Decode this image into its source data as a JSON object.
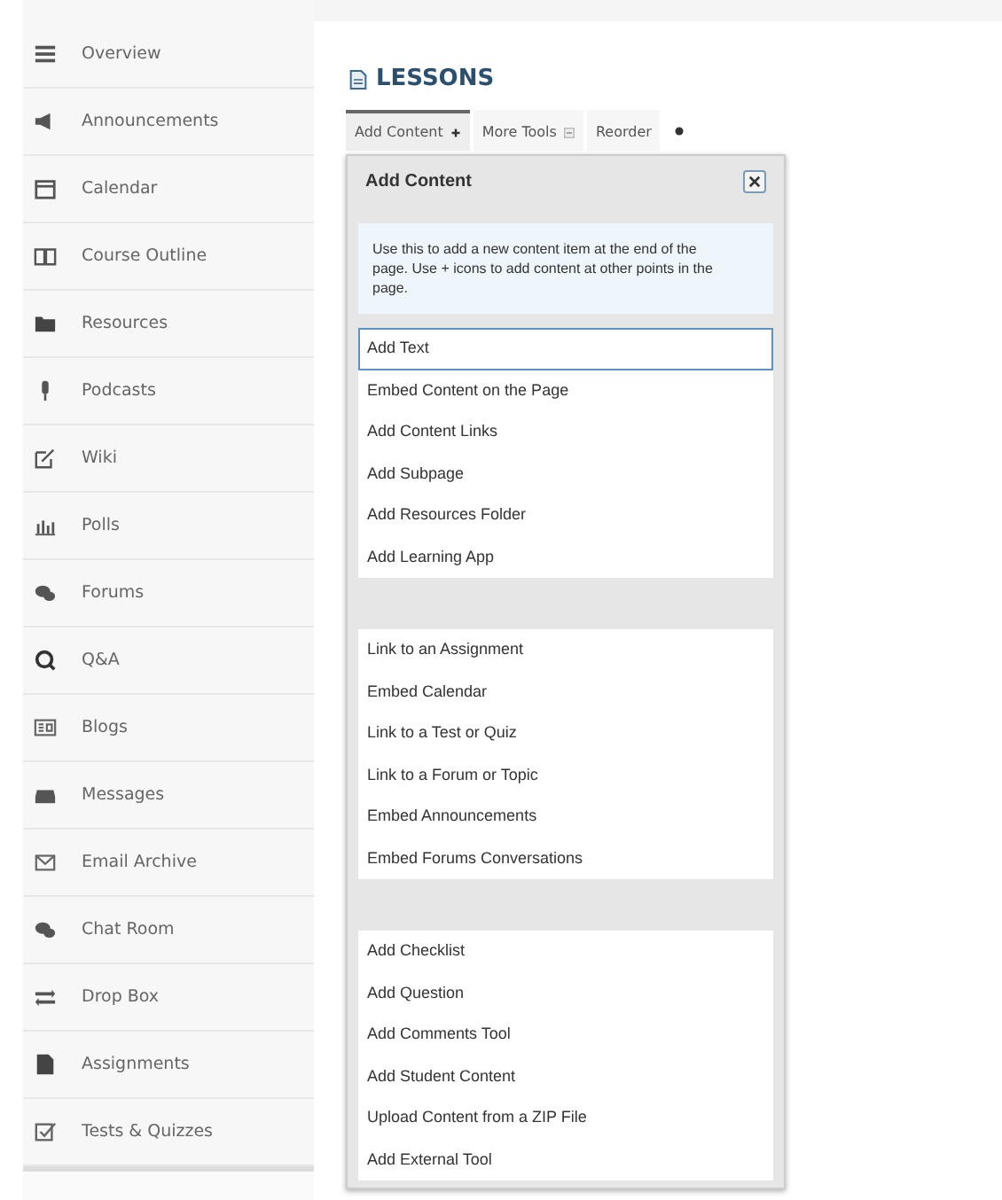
{
  "sidebar": {
    "items": [
      {
        "label": "Overview"
      },
      {
        "label": "Announcements"
      },
      {
        "label": "Calendar"
      },
      {
        "label": "Course Outline"
      },
      {
        "label": "Resources"
      },
      {
        "label": "Podcasts"
      },
      {
        "label": "Wiki"
      },
      {
        "label": "Polls"
      },
      {
        "label": "Forums"
      },
      {
        "label": "Q&A"
      },
      {
        "label": "Blogs"
      },
      {
        "label": "Messages"
      },
      {
        "label": "Email Archive"
      },
      {
        "label": "Chat Room"
      },
      {
        "label": "Drop Box"
      },
      {
        "label": "Assignments"
      },
      {
        "label": "Tests & Quizzes"
      }
    ]
  },
  "page_title": "LESSONS",
  "tabs": [
    {
      "label": "Add Content",
      "selected": true
    },
    {
      "label": "More Tools",
      "selected": false
    },
    {
      "label": "Reorder",
      "selected": false
    }
  ],
  "dialog": {
    "title": "Add Content",
    "info": "Use this to add a new content item at the end of the page. Use + icons to add content at other points in the page.",
    "groups": [
      [
        {
          "label": "Add Text",
          "selected": true
        },
        {
          "label": "Embed Content on the Page",
          "selected": false
        },
        {
          "label": "Add Content Links",
          "selected": false
        },
        {
          "label": "Add Subpage",
          "selected": false
        },
        {
          "label": "Add Resources Folder",
          "selected": false
        },
        {
          "label": "Add Learning App",
          "selected": false
        }
      ],
      [
        {
          "label": "Link to an Assignment",
          "selected": false
        },
        {
          "label": "Embed Calendar",
          "selected": false
        },
        {
          "label": "Link to a Test or Quiz",
          "selected": false
        },
        {
          "label": "Link to a Forum or Topic",
          "selected": false
        },
        {
          "label": "Embed Announcements",
          "selected": false
        },
        {
          "label": "Embed Forums Conversations",
          "selected": false
        }
      ],
      [
        {
          "label": "Add Checklist",
          "selected": false
        },
        {
          "label": "Add Question",
          "selected": false
        },
        {
          "label": "Add Comments Tool",
          "selected": false
        },
        {
          "label": "Add Student Content",
          "selected": false
        },
        {
          "label": "Upload Content from a ZIP File",
          "selected": false
        },
        {
          "label": "Add External Tool",
          "selected": false
        }
      ]
    ]
  }
}
